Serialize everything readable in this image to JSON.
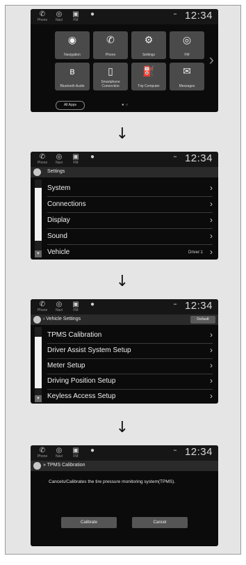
{
  "status_bar": {
    "phone": "Phone",
    "nav": "Navi",
    "fm": "FM",
    "clock": "12:34"
  },
  "home": {
    "tiles": [
      {
        "label": "Navigation",
        "icon": "◉"
      },
      {
        "label": "Phone",
        "icon": "✆"
      },
      {
        "label": "Settings",
        "icon": "⚙"
      },
      {
        "label": "FM",
        "icon": "◎"
      },
      {
        "label": "Bluetooth Audio",
        "icon": "ʙ"
      },
      {
        "label": "Smartphone Connection",
        "icon": "▯"
      },
      {
        "label": "Trip Computer",
        "icon": "⛽"
      },
      {
        "label": "Messages",
        "icon": "✉"
      }
    ],
    "all_apps": "All Apps"
  },
  "settings": {
    "title": "Settings",
    "items": [
      {
        "label": "System"
      },
      {
        "label": "Connections"
      },
      {
        "label": "Display"
      },
      {
        "label": "Sound"
      },
      {
        "label": "Vehicle",
        "value": "Driver:1"
      }
    ]
  },
  "vehicle_settings": {
    "title": "Vehicle Settings",
    "default_button": "Default",
    "items": [
      {
        "label": "TPMS Calibration"
      },
      {
        "label": "Driver Assist System Setup"
      },
      {
        "label": "Meter Setup"
      },
      {
        "label": "Driving Position Setup"
      },
      {
        "label": "Keyless Access Setup"
      }
    ]
  },
  "tpms": {
    "title": "TPMS Calibration",
    "description": "Cancels/Calibrates the tire pressure monitoring system(TPMS).",
    "calibrate_button": "Calibrate",
    "cancel_button": "Cancel"
  },
  "flow_arrow": "↓"
}
